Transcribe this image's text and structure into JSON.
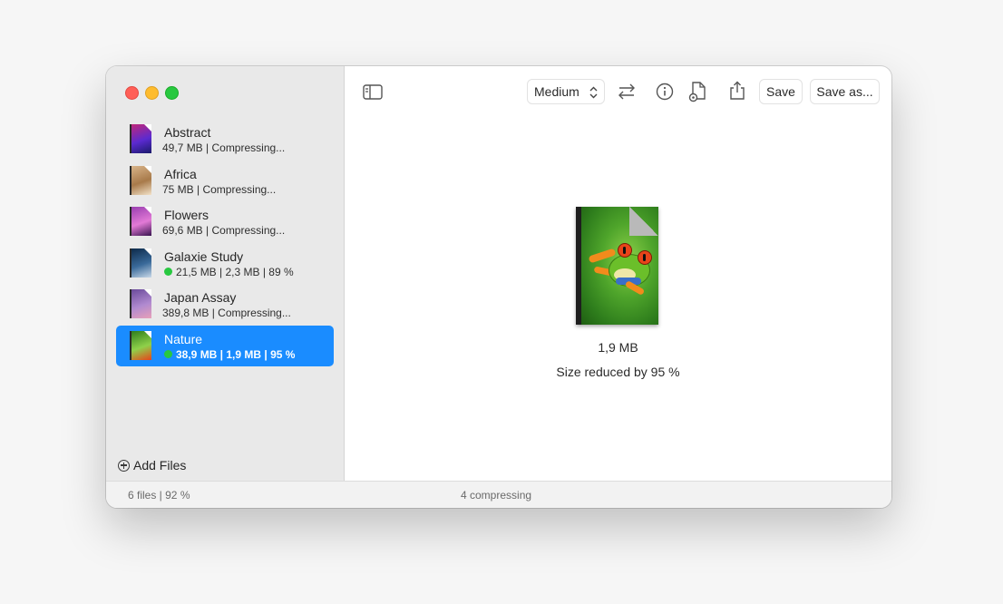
{
  "window": {
    "traffic_lights": [
      "close",
      "minimize",
      "maximize"
    ]
  },
  "sidebar": {
    "files": [
      {
        "name": "Abstract",
        "meta": "49,7 MB | Compressing...",
        "done": false,
        "thumb_colors": [
          "#c0287a",
          "#5b2ad0",
          "#1a1a6a"
        ]
      },
      {
        "name": "Africa",
        "meta": "75 MB | Compressing...",
        "done": false,
        "thumb_colors": [
          "#d8b48a",
          "#a87a4a",
          "#f2e2c8"
        ]
      },
      {
        "name": "Flowers",
        "meta": "69,6 MB | Compressing...",
        "done": false,
        "thumb_colors": [
          "#9a3fb0",
          "#e27ad6",
          "#3a1450"
        ]
      },
      {
        "name": "Galaxie Study",
        "meta": "21,5 MB | 2,3 MB | 89 %",
        "done": true,
        "thumb_colors": [
          "#0d2a4a",
          "#3a6a9a",
          "#c8d8e8"
        ]
      },
      {
        "name": "Japan Assay",
        "meta": "389,8 MB | Compressing...",
        "done": false,
        "thumb_colors": [
          "#6a4a9a",
          "#b08ad0",
          "#e8a0b8"
        ]
      },
      {
        "name": "Nature",
        "meta": "38,9 MB | 1,9 MB | 95 %",
        "done": true,
        "selected": true,
        "thumb_colors": [
          "#2e7d1c",
          "#8fd14a",
          "#e8441a"
        ]
      }
    ],
    "add_files_label": "Add Files"
  },
  "toolbar": {
    "sidebar_toggle_icon": "sidebar-toggle-icon",
    "quality_select": "Medium",
    "compare_icon": "swap-arrows-icon",
    "info_icon": "info-icon",
    "settings_icon": "document-gear-icon",
    "share_icon": "share-icon",
    "save_label": "Save",
    "save_as_label": "Save as..."
  },
  "preview": {
    "size": "1,9 MB",
    "reduction": "Size reduced by 95 %"
  },
  "statusbar": {
    "left": "6 files | 92 %",
    "center": "4 compressing"
  },
  "colors": {
    "accent": "#1a8cff",
    "done_dot": "#28c840"
  }
}
